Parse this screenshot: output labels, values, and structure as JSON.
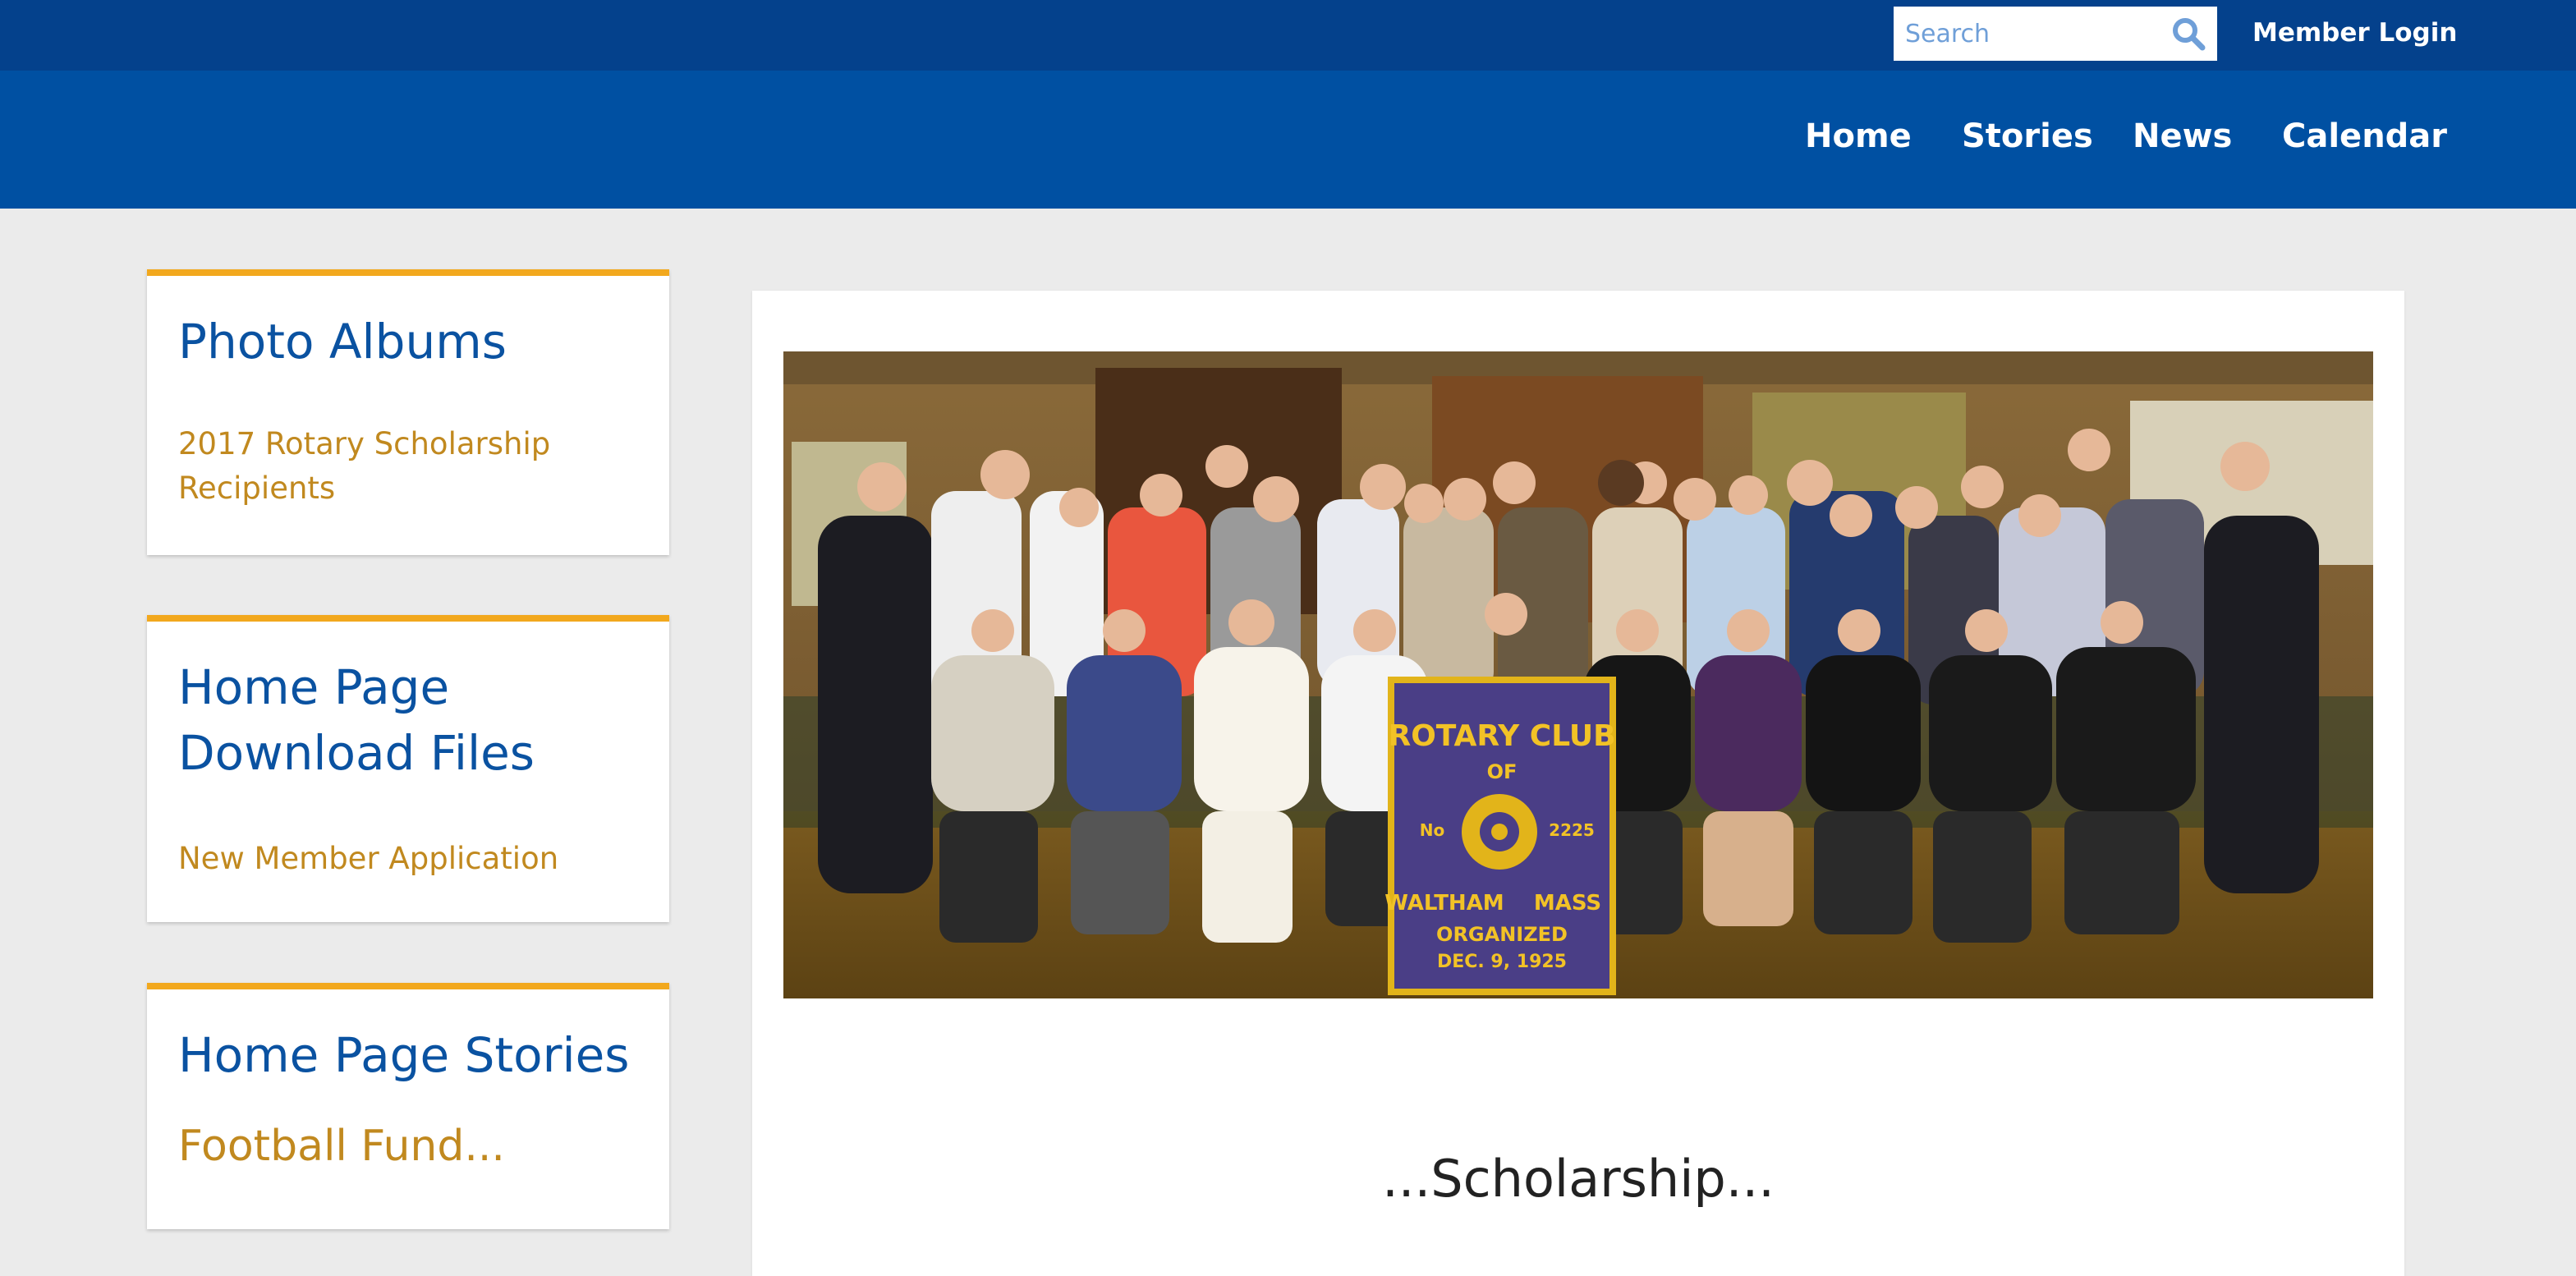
{
  "topbar": {
    "search_placeholder": "Search",
    "member_login": "Member Login"
  },
  "nav": {
    "items": [
      "Home",
      "Stories",
      "News",
      "Calendar"
    ]
  },
  "sidebar": {
    "cards": [
      {
        "title": "Photo Albums",
        "link": "2017 Rotary Scholarship Recipients"
      },
      {
        "title": "Home Page Download Files",
        "link": "New Member Application"
      },
      {
        "title": "Home Page Stories",
        "link": "Football Fund..."
      }
    ]
  },
  "main": {
    "banner": {
      "line1": "ROTARY CLUB",
      "line2": "OF",
      "no_label": "No",
      "number": "2225",
      "city": "WALTHAM",
      "state": "MASS",
      "organized": "ORGANIZED",
      "date": "DEC. 9, 1925"
    },
    "heading": "...Scholarship..."
  },
  "colors": {
    "topbar": "#04418c",
    "navbar": "#0050a2",
    "accent": "#f2a81d",
    "title": "#0a52a1",
    "link": "#c1891f",
    "background": "#ebebeb"
  },
  "icons": {
    "search": "search-icon"
  }
}
